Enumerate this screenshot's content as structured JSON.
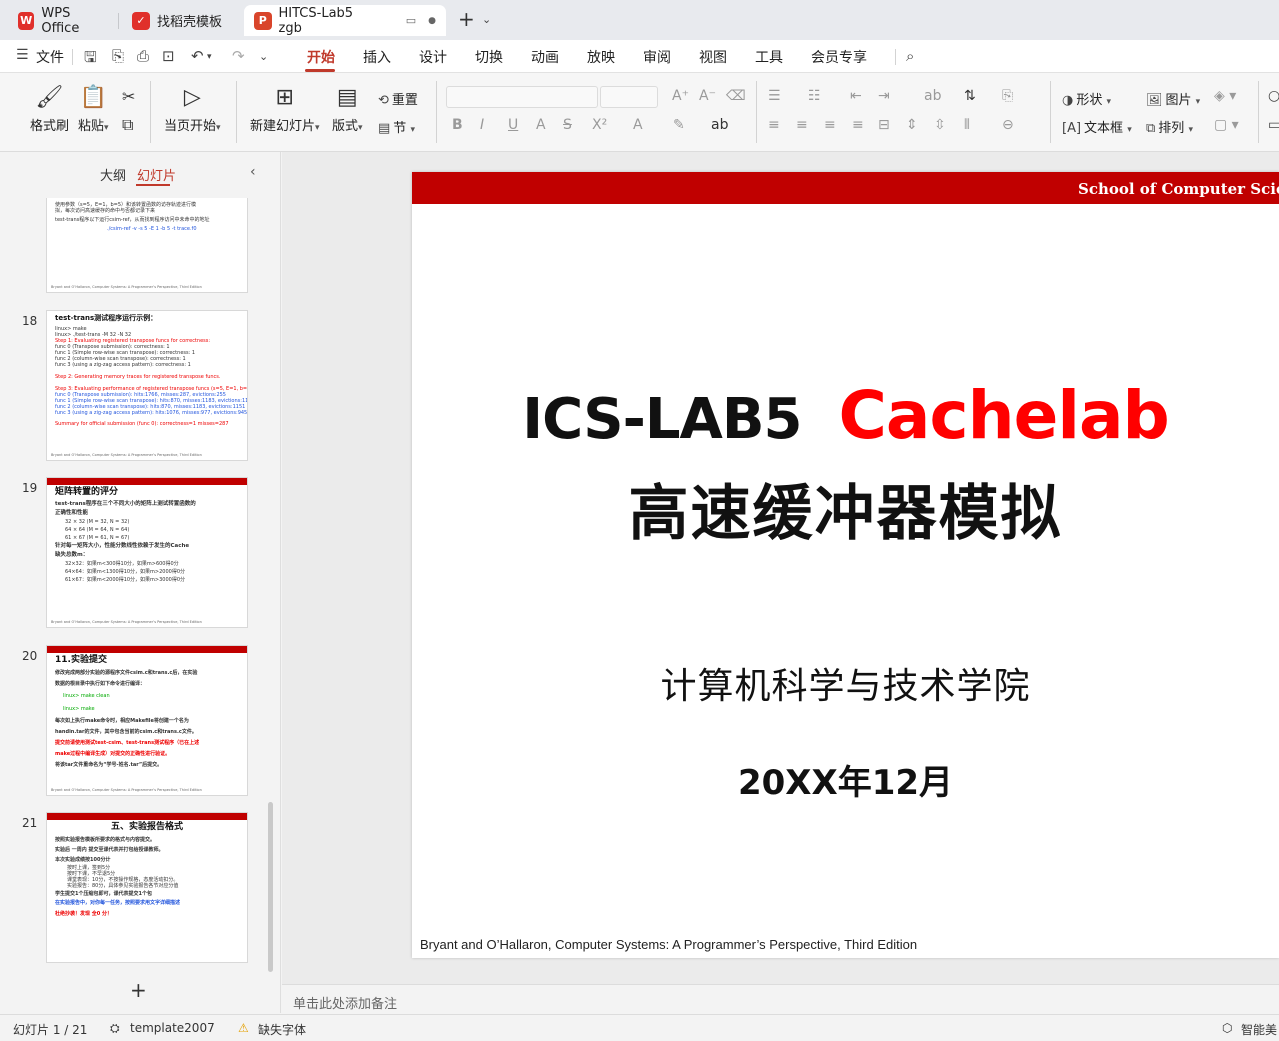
{
  "titlebar": {
    "tabs": [
      {
        "label": "WPS Office",
        "icon": "wps-logo-icon",
        "color": "#e0302b"
      },
      {
        "label": "找稻壳模板",
        "icon": "docer-logo-icon",
        "color": "#e0302b"
      },
      {
        "label": "HITCS-Lab5 zgb",
        "icon": "presentation-logo-icon",
        "color": "#d9452b"
      }
    ],
    "new_tab_symbol": "+",
    "new_tab_menu_symbol": "⌄"
  },
  "menubar": {
    "file": "文件",
    "items": [
      "开始",
      "插入",
      "设计",
      "切换",
      "动画",
      "放映",
      "审阅",
      "视图",
      "工具",
      "会员专享"
    ],
    "active": "开始"
  },
  "ribbon": {
    "format_painter": "格式刷",
    "paste": "粘贴",
    "from_current": "当页开始",
    "new_slide": "新建幻灯片",
    "layout": "版式",
    "reset": "重置",
    "section": "节",
    "shape": "形状",
    "image": "图片",
    "textbox": "文本框",
    "arrange": "排列"
  },
  "left_panel": {
    "tab_outline": "大纲",
    "tab_slides": "幻灯片",
    "slides": [
      {
        "num": "17",
        "lines": [
          "使用参数（s=5，E=1，b=5）和该转置函数的访存轨迹进行模",
          "拟，每次访问高速缓存的命中与否都记录下来",
          "test-trans程序以下运行csim-ref，从而找到程序访问中未命中的地址",
          "./csim-ref -v -s 5 -E 1 -b 5 -t trace.f0"
        ]
      },
      {
        "num": "18",
        "title": "test-trans测试程序运行示例：",
        "lines": [
          "linux> make",
          "linux> ./test-trans -M 32 -N 32",
          "Step 1: Evaluating registered transpose funcs for correctness:",
          "func 0 (Transpose submission): correctness: 1",
          "func 1 (Simple row-wise scan transpose): correctness: 1",
          "func 2 (column-wise scan transpose): correctness: 1",
          "func 3 (using a zig-zag access pattern): correctness: 1",
          "Step 2: Generating memory traces for registered transpose funcs.",
          "Step 3: Evaluating performance of registered transpose funcs (s=5, E=1, b=5)",
          "func 0 (Transpose submission): hits:1766, misses:287, evictions:255",
          "func 1 (Simple row-wise scan transpose): hits:870, misses:1183, evictions:1151",
          "func 2 (column-wise scan transpose): hits:870, misses:1183, evictions:1151",
          "func 3 (using a zig-zag access pattern): hits:1076, misses:977, evictions:945",
          "Summary for official submission (func 0): correctness=1 misses=287"
        ]
      },
      {
        "num": "19",
        "title": "矩阵转置的评分",
        "lines": [
          "test-trans程序在三个不同大小的矩阵上测试转置函数的",
          "正确性和性能",
          "32 × 32 (M = 32, N = 32)",
          "64 × 64 (M = 64, N = 64)",
          "61 × 67 (M = 61, N = 67)",
          "针对每一矩阵大小，性能分数线性依赖于发生的Cache",
          "缺失总数m：",
          "32×32：如果m<300得10分，如果m>600得0分",
          "64×64：如果m<1300得10分，如果m>2000得0分",
          "61×67：如果m<2000得10分，如果m>3000得0分"
        ]
      },
      {
        "num": "20",
        "title": "11.实验提交",
        "lines": [
          "修改完成两部分实验的源程序文件csim.c和trans.c后，在实验",
          "数据的根目录中执行如下命令进行编译：",
          "linux> make clean",
          "linux> make",
          "每次如上执行make命令时，相应Makefile将创建一个名为",
          "handin.tar的文件，其中包含当前的csim.c和trans.c文件。",
          "提交前请使用测试test-csim、test-trans测试程序（已在上述",
          "make过程中编译生成）对提交的正确性进行验证。",
          "将该tar文件重命名为“学号-姓名.tar”后提交。"
        ]
      },
      {
        "num": "21",
        "title": "五、实验报告格式",
        "lines": [
          "按照实验报告模板所要求的格式与内容提交。",
          "实验后 一周内 提交至课代表并打包给授课教师。",
          "本次实验成绩按100分计",
          "按时上课，签到5分",
          "按时下课，不早退5分",
          "课堂表现：10分，不按操作规格，态度活动扣分。",
          "实验报告：80分，具体参见实验报告各节对应分值",
          "学生提交1个压缩包即可，课代表提交1个包",
          "在实验报告中，对你每一任务，按照要求用文字详细描述",
          "杜绝抄袭！发现 全0 分！"
        ]
      }
    ],
    "add_symbol": "+"
  },
  "slide": {
    "banner_text": "School of Computer Science and Technology, HIT",
    "title_black": "ICS-LAB5",
    "title_red": "Cachelab",
    "subtitle": "高速缓冲器模拟",
    "college": "计算机科学与技术学院",
    "date": "20XX年12月",
    "footer": "Bryant and O’Hallaron, Computer Systems: A Programmer’s Perspective, Third Edition",
    "colors": {
      "banner": "#c00000",
      "title_red": "#ff0000"
    }
  },
  "notes": {
    "placeholder": "单击此处添加备注"
  },
  "statusbar": {
    "slide_counter": "幻灯片 1 / 21",
    "template": "template2007",
    "missing_font": "缺失字体",
    "smart": "智能美"
  }
}
